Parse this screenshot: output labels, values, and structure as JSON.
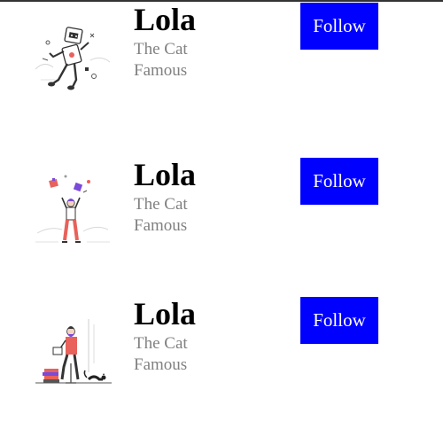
{
  "colors": {
    "button_bg": "#0000ff",
    "button_text": "#ffffff",
    "subtitle": "#808080",
    "name": "#000000"
  },
  "cards": [
    {
      "illustration_icon": "juggling-person-illustration",
      "name": "Lola",
      "subtitle": "The Cat Famous",
      "button_label": "Follow"
    },
    {
      "illustration_icon": "seated-person-with-cat-illustration",
      "name": "Lola",
      "subtitle": "The Cat Famous",
      "button_label": "Follow"
    },
    {
      "illustration_icon": "broken-robot-illustration",
      "name": "Lola",
      "subtitle": "The Cat Famous",
      "button_label": "Follow"
    }
  ]
}
